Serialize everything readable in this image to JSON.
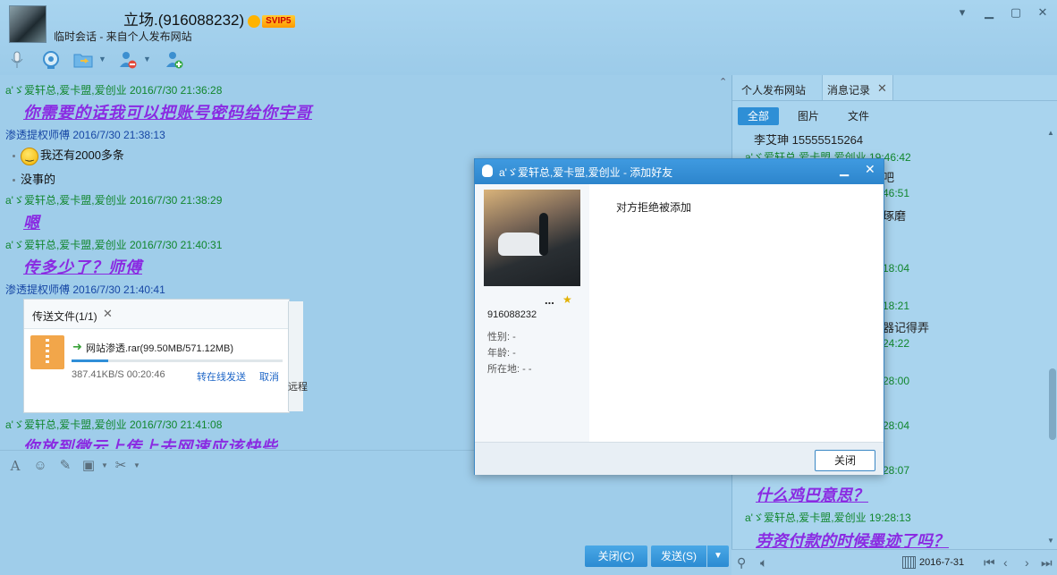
{
  "header": {
    "title": "立场.(916088232)",
    "vip_badge": "SVIP5",
    "subtitle": "临时会话 - 来自个人发布网站",
    "window_controls": [
      "chevron-down-icon",
      "minimize-icon",
      "maximize-icon",
      "close-icon"
    ],
    "toolbar_icons": [
      "microphone-icon",
      "video-camera-icon",
      "folder-transfer-icon",
      "remove-user-icon",
      "add-user-icon"
    ]
  },
  "chat": {
    "messages": [
      {
        "sender": "a'ゞ爱轩总,爱卡盟,爱创业 2016/7/30 21:36:28",
        "text": "你需要的话我可以把账号密码给你宇哥"
      },
      {
        "sender": "渗透提权师傅 2016/7/30 21:38:13",
        "lines": [
          "我还有2000多条",
          "没事的"
        ]
      },
      {
        "sender": "a'ゞ爱轩总,爱卡盟,爱创业 2016/7/30 21:38:29",
        "text": "嗯"
      },
      {
        "sender": "a'ゞ爱轩总,爱卡盟,爱创业 2016/7/30 21:40:31",
        "text": "传多少了？师傅"
      },
      {
        "sender": "渗透提权师傅 2016/7/30 21:40:41"
      },
      {
        "sender": "a'ゞ爱轩总,爱卡盟,爱创业 2016/7/30 21:41:08",
        "text": "你放到微云上传上去网速应该快些"
      }
    ],
    "transfer": {
      "tab_label": "传送文件(1/1)",
      "file_name": "网站渗透.rar(99.50MB/571.12MB)",
      "progress": 0.174,
      "speed_time": "387.41KB/S 00:20:46",
      "online_link": "转在线发送",
      "cancel_link": "取消",
      "edge_text": "远程"
    }
  },
  "input": {
    "icons": [
      "font-icon",
      "emoji-icon",
      "edit-icon",
      "image-icon",
      "scissors-icon"
    ],
    "close_button": "关闭(C)",
    "send_button": "发送(S)"
  },
  "right_panel": {
    "tabs": [
      "个人发布网站",
      "消息记录"
    ],
    "filters": [
      "全部",
      "图片",
      "文件"
    ],
    "entries": [
      "李艾珅   15555515264",
      "a'ゞ爱轩总,爱卡盟,爱创业 19:46:42",
      "吧",
      "46:51",
      "琢磨",
      "18:04",
      "18:21",
      "器记得弄",
      "24:22",
      "28:00",
      "28:04",
      "28:07",
      "什么鸡巴意思？",
      "a'ゞ爱轩总,爱卡盟,爱创业 19:28:13",
      "劳资付款的时候墨迹了吗？"
    ],
    "date": "2016-7-31"
  },
  "dialog": {
    "title": "a'ゞ爱轩总,爱卡盟,爱创业 - 添加好友",
    "message": "对方拒绝被添加",
    "more": "...",
    "qq_number": "916088232",
    "gender": "性别: -",
    "age": "年龄: -",
    "location": "所在地: -   -",
    "close_button": "关闭"
  },
  "colors": {
    "background": "#9fcdea",
    "accent": "#2e8fd6",
    "art_text": "#8a2be2",
    "sender_green": "#11862d",
    "sender_blue": "#1747a5"
  }
}
